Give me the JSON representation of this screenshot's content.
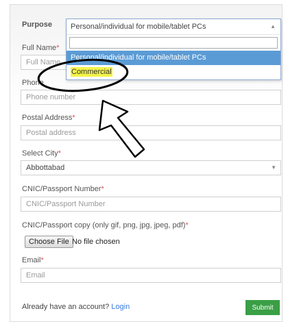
{
  "form": {
    "purpose": {
      "label": "Purpose",
      "selected": "Personal/individual for mobile/tablet PCs",
      "search_value": "",
      "options": [
        "Personal/individual for mobile/tablet PCs",
        "Commercial"
      ],
      "highlighted_option": "Commercial"
    },
    "full_name": {
      "label": "Full Name",
      "required_mark": "*",
      "placeholder": "Full Name"
    },
    "phone": {
      "label": "Phone",
      "placeholder": "Phone number"
    },
    "postal": {
      "label": "Postal Address",
      "required_mark": "*",
      "placeholder": "Postal address"
    },
    "city": {
      "label": "Select City",
      "required_mark": "*",
      "selected": "Abbottabad"
    },
    "cnic": {
      "label": "CNIC/Passport Number",
      "required_mark": "*",
      "placeholder": "CNIC/Passport Number"
    },
    "cnic_copy": {
      "label": "CNIC/Passport copy (only gif, png, jpg, jpeg, pdf)",
      "required_mark": "*",
      "button": "Choose File",
      "status": "No file chosen"
    },
    "email": {
      "label": "Email",
      "required_mark": "*",
      "placeholder": "Email"
    },
    "account_text": "Already have an account?",
    "login_link": "Login",
    "submit": "Submit"
  },
  "colors": {
    "active_option": "#5b9bd5",
    "highlight": "#f3f34a",
    "submit": "#3a9f45",
    "required": "#d9534f"
  }
}
